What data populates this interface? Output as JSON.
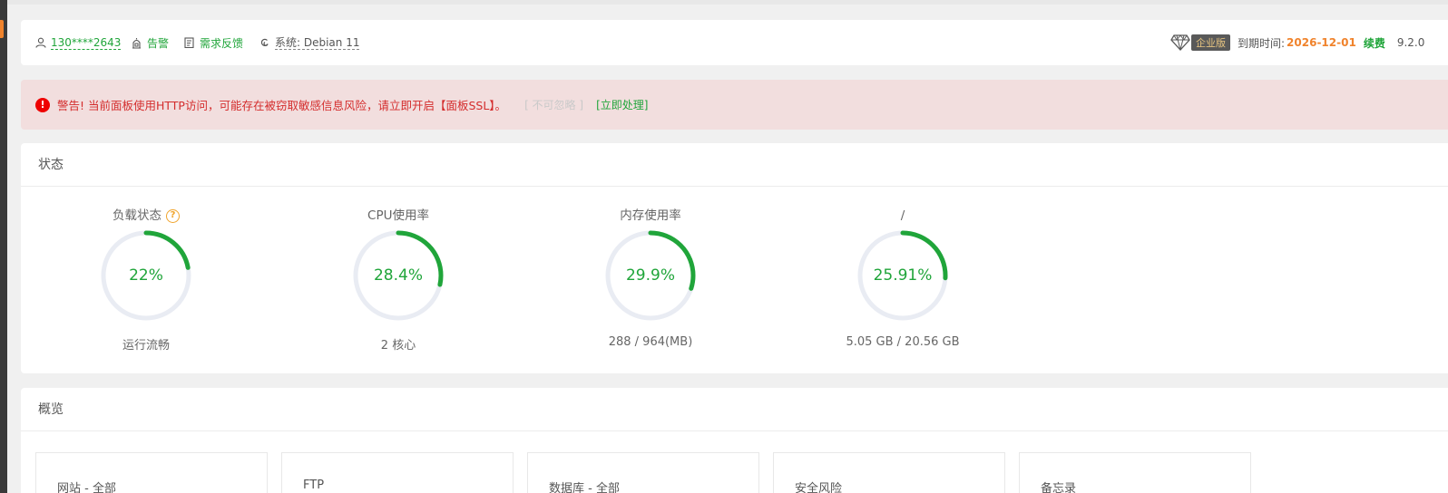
{
  "header": {
    "user_phone": "130****2643",
    "alarm_label": "告警",
    "feedback_label": "需求反馈",
    "system_label": "系统: Debian 11",
    "edition_badge": "企业版",
    "expire_label": "到期时间:",
    "expire_date": "2026-12-01",
    "renew_label": "续费",
    "version": "9.2.0"
  },
  "alert": {
    "icon": "!",
    "message": "警告! 当前面板使用HTTP访问，可能存在被窃取敏感信息风险，请立即开启【面板SSL】。",
    "ignore_label": "[ 不可忽略 ]",
    "action_label": "[立即处理]"
  },
  "status": {
    "title": "状态",
    "gauges": [
      {
        "label": "负载状态",
        "value": "22%",
        "percent": 22,
        "sub": "运行流畅",
        "help": "?"
      },
      {
        "label": "CPU使用率",
        "value": "28.4%",
        "percent": 28.4,
        "sub": "2 核心"
      },
      {
        "label": "内存使用率",
        "value": "29.9%",
        "percent": 29.9,
        "sub": "288 / 964(MB)"
      },
      {
        "label": "/",
        "value": "25.91%",
        "percent": 25.91,
        "sub": "5.05 GB / 20.56 GB"
      }
    ]
  },
  "overview": {
    "title": "概览",
    "tiles": [
      "网站 - 全部",
      "FTP",
      "数据库 - 全部",
      "安全风险",
      "备忘录"
    ]
  },
  "colors": {
    "accent_green": "#20a53a",
    "warning_orange": "#f0832c",
    "alert_bg": "#f2dede",
    "alert_red": "#d42c2c",
    "ring_track": "#e9ecf3"
  }
}
